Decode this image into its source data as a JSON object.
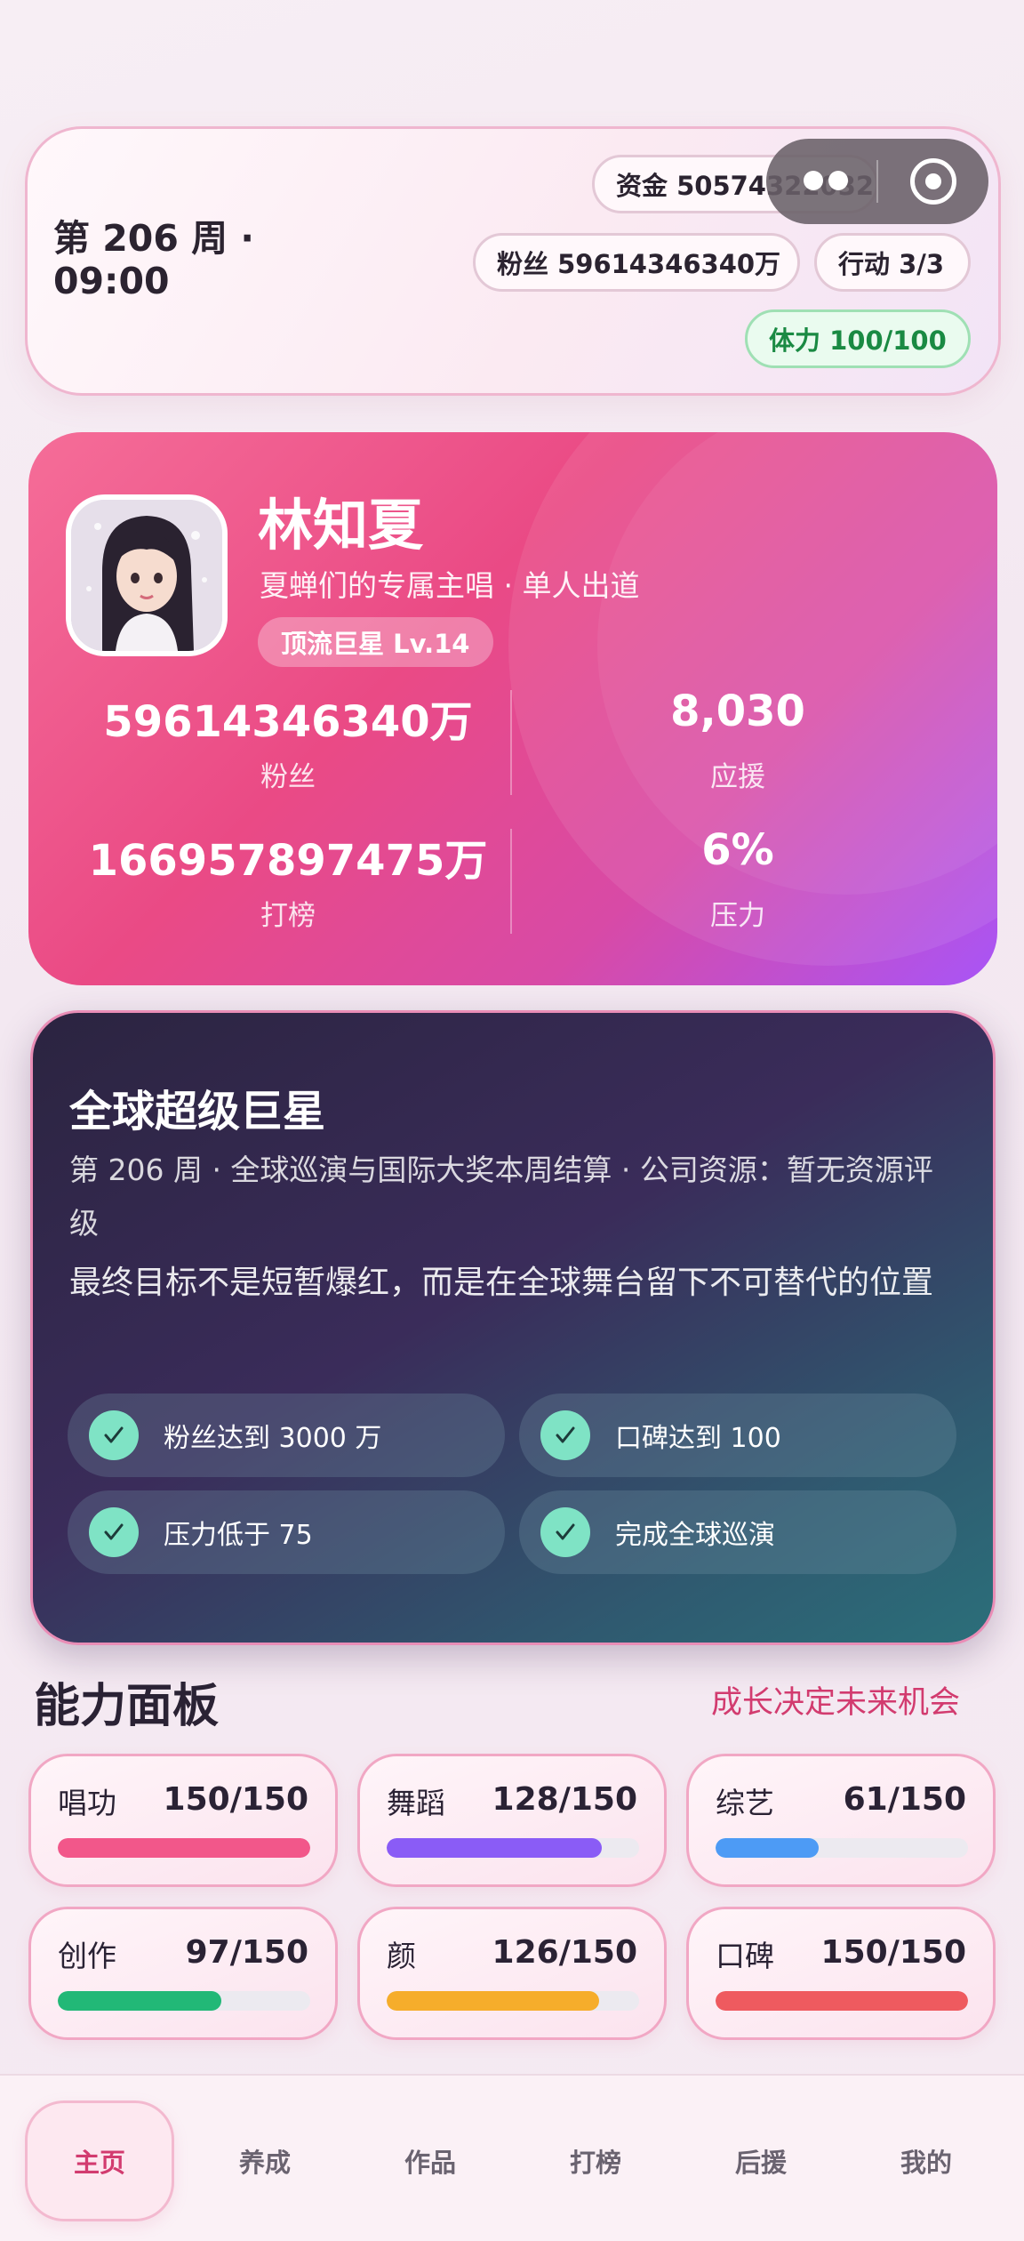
{
  "status": {
    "week_time": "第 206 周 · 09:00",
    "funds": "资金 50574322032333",
    "fans": "粉丝 59614346340万",
    "action": "行动 3/3",
    "stamina": "体力 100/100"
  },
  "profile": {
    "name": "林知夏",
    "subtitle": "夏蝉们的专属主唱 · 单人出道",
    "level": "顶流巨星 Lv.14",
    "stats": [
      {
        "value": "59614346340万",
        "label": "粉丝"
      },
      {
        "value": "8,030",
        "label": "应援"
      },
      {
        "value": "166957897475万",
        "label": "打榜"
      },
      {
        "value": "6%",
        "label": "压力"
      }
    ]
  },
  "goal": {
    "title": "全球超级巨星",
    "description": "第 206 周 · 全球巡演与国际大奖本周结算 · 公司资源：暂无资源评级",
    "motto": "最终目标不是短暂爆红，而是在全球舞台留下不可替代的位置",
    "items": [
      {
        "text": "粉丝达到 3000 万",
        "done": true
      },
      {
        "text": "口碑达到 100",
        "done": true
      },
      {
        "text": "压力低于 75",
        "done": true
      },
      {
        "text": "完成全球巡演",
        "done": true
      }
    ]
  },
  "abilities": {
    "title": "能力面板",
    "hint": "成长决定未来机会",
    "items": [
      {
        "label": "唱功",
        "value": "150/150",
        "ratio": 1.0,
        "color": "#f2578a"
      },
      {
        "label": "舞蹈",
        "value": "128/150",
        "ratio": 0.853,
        "color": "#8a5cf6"
      },
      {
        "label": "综艺",
        "value": "61/150",
        "ratio": 0.407,
        "color": "#4d9bf5"
      },
      {
        "label": "创作",
        "value": "97/150",
        "ratio": 0.647,
        "color": "#22b877"
      },
      {
        "label": "颜",
        "value": "126/150",
        "ratio": 0.84,
        "color": "#f6ad2b"
      },
      {
        "label": "口碑",
        "value": "150/150",
        "ratio": 1.0,
        "color": "#ef5a5f"
      }
    ]
  },
  "nav": {
    "items": [
      "主页",
      "养成",
      "作品",
      "打榜",
      "后援",
      "我的"
    ],
    "active": "主页"
  }
}
